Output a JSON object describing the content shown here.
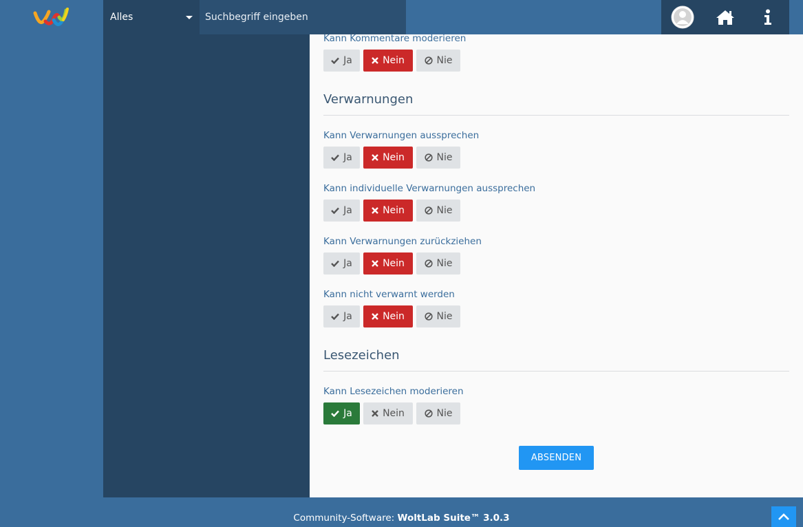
{
  "header": {
    "logo_icon": "woltlab-logo-icon",
    "search_scope": "Alles",
    "search_placeholder": "Suchbegriff eingeben",
    "nav_icons": [
      "user-avatar-icon",
      "home-icon",
      "info-icon"
    ]
  },
  "buttons": {
    "yes": "Ja",
    "no": "Nein",
    "never": "Nie"
  },
  "permissions": {
    "moderate_comments": {
      "label": "Kann Kommentare moderieren",
      "selected": "no"
    },
    "warnings_title": "Verwarnungen",
    "issue_warnings": {
      "label": "Kann Verwarnungen aussprechen",
      "selected": "no"
    },
    "issue_custom_warnings": {
      "label": "Kann individuelle Verwarnungen aussprechen",
      "selected": "no"
    },
    "revoke_warnings": {
      "label": "Kann Verwarnungen zurückziehen",
      "selected": "no"
    },
    "immune_warnings": {
      "label": "Kann nicht verwarnt werden",
      "selected": "no"
    },
    "bookmarks_title": "Lesezeichen",
    "moderate_bookmarks": {
      "label": "Kann Lesezeichen moderieren",
      "selected": "yes"
    }
  },
  "form": {
    "submit_label": "ABSENDEN"
  },
  "footer": {
    "prefix": "Community-Software: ",
    "product": "WoltLab Suite™ 3.0.3"
  },
  "colors": {
    "brand_blue": "#3a6d9c",
    "dark_blue": "#264562",
    "no_selected": "#cb2929",
    "yes_selected": "#2a7a3a",
    "primary_button": "#2196f3"
  }
}
